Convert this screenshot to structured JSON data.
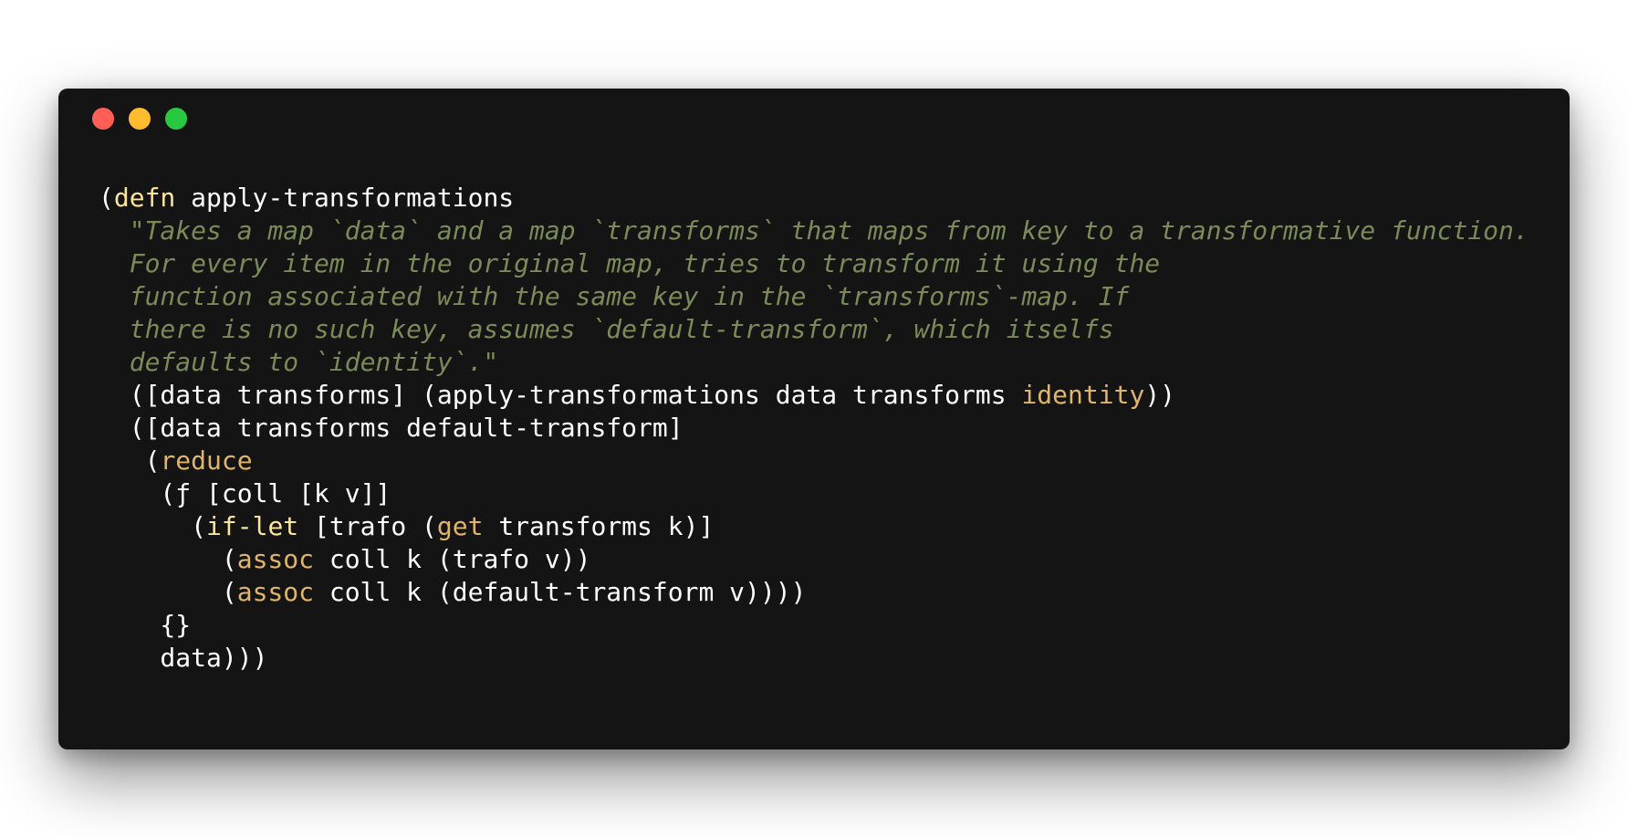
{
  "window": {
    "buttons": {
      "close": {
        "label": "close window",
        "color": "#ff5f57"
      },
      "minimize": {
        "label": "minimize window",
        "color": "#febc2e"
      },
      "zoom": {
        "label": "zoom window",
        "color": "#28c840"
      }
    }
  },
  "colors": {
    "background": "#141414",
    "text": "#ffffff",
    "keyword": "#fbe59c",
    "builtin": "#dfb56d",
    "docstring": "#7c8a59"
  },
  "code": {
    "lines": [
      [
        {
          "t": "("
        },
        {
          "t": "defn",
          "c": "kw"
        },
        {
          "t": " apply-transformations"
        }
      ],
      [
        {
          "t": "  \"Takes a map `data` and a map `transforms` that maps from key to a transformative function.",
          "c": "str"
        }
      ],
      [
        {
          "t": "  For every item in the original map, tries to transform it using the",
          "c": "str"
        }
      ],
      [
        {
          "t": "  function associated with the same key in the `transforms`-map. If",
          "c": "str"
        }
      ],
      [
        {
          "t": "  there is no such key, assumes `default-transform`, which itselfs",
          "c": "str"
        }
      ],
      [
        {
          "t": "  defaults to `identity`.\"",
          "c": "str"
        }
      ],
      [
        {
          "t": "  ([data transforms] (apply-transformations data transforms "
        },
        {
          "t": "identity",
          "c": "fn"
        },
        {
          "t": "))"
        }
      ],
      [
        {
          "t": "  ([data transforms default-transform]"
        }
      ],
      [
        {
          "t": "   ("
        },
        {
          "t": "reduce",
          "c": "fn"
        }
      ],
      [
        {
          "t": "    (ƒ [coll [k v]]"
        }
      ],
      [
        {
          "t": "      ("
        },
        {
          "t": "if-let",
          "c": "kw"
        },
        {
          "t": " [trafo ("
        },
        {
          "t": "get",
          "c": "fn"
        },
        {
          "t": " transforms k)]"
        }
      ],
      [
        {
          "t": "        ("
        },
        {
          "t": "assoc",
          "c": "fn"
        },
        {
          "t": " coll k (trafo v))"
        }
      ],
      [
        {
          "t": "        ("
        },
        {
          "t": "assoc",
          "c": "fn"
        },
        {
          "t": " coll k (default-transform v))))"
        }
      ],
      [
        {
          "t": "    {}"
        }
      ],
      [
        {
          "t": "    data)))"
        }
      ]
    ]
  }
}
